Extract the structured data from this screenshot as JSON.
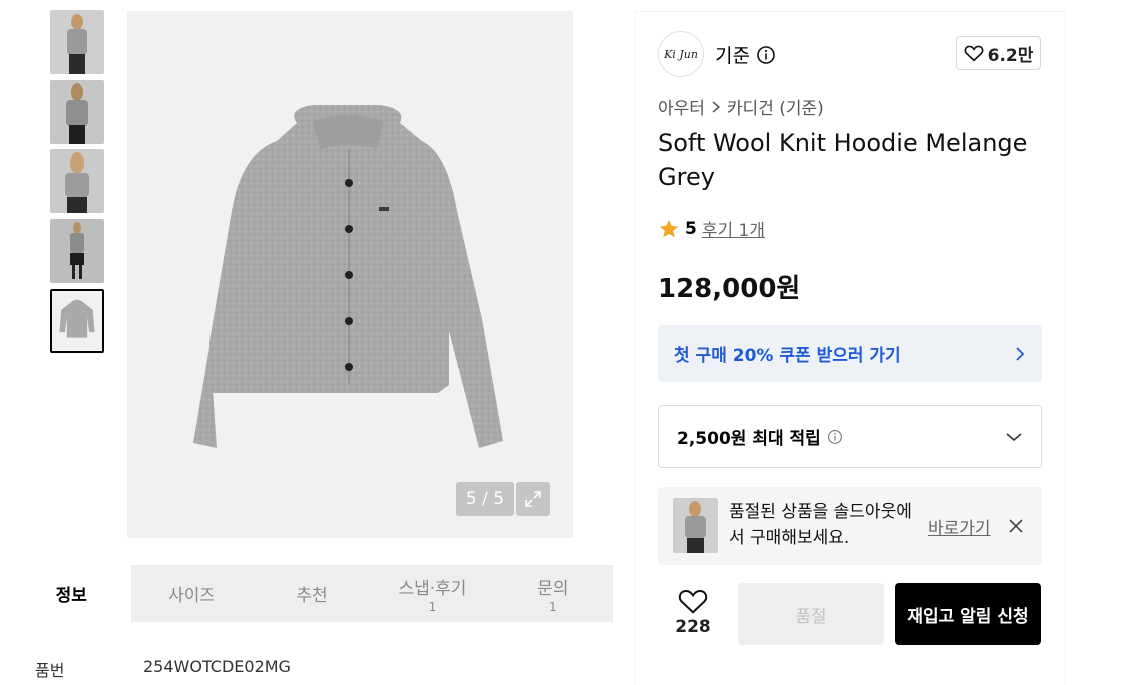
{
  "gallery": {
    "counter": "5 / 5",
    "thumbnails": [
      {
        "icon": "model-front-photo"
      },
      {
        "icon": "model-back-photo"
      },
      {
        "icon": "model-side-photo"
      },
      {
        "icon": "model-full-photo"
      },
      {
        "icon": "product-flat-photo",
        "selected": true
      }
    ]
  },
  "tabs": [
    {
      "label": "정보",
      "count": ""
    },
    {
      "label": "사이즈",
      "count": ""
    },
    {
      "label": "추천",
      "count": ""
    },
    {
      "label": "스냅·후기",
      "count": "1"
    },
    {
      "label": "문의",
      "count": "1"
    }
  ],
  "detail": {
    "label": "품번",
    "value": "254WOTCDE02MG"
  },
  "brand": {
    "logo_text": "Ki Jun",
    "name": "기준",
    "likes": "6.2만"
  },
  "breadcrumb": {
    "level1": "아우터",
    "level2": "카디건 (기준)"
  },
  "product": {
    "title": "Soft Wool Knit Hoodie Melange Grey",
    "rating": "5",
    "reviews": "후기 1개",
    "price": "128,000원"
  },
  "coupon": {
    "label": "첫 구매 20% 쿠폰 받으러 가기"
  },
  "points": {
    "label": "2,500원 최대 적립"
  },
  "soldout_notice": {
    "text": "품절된 상품을 솔드아웃에서 구매해보세요.",
    "link": "바로가기"
  },
  "actions": {
    "wish_count": "228",
    "soldout_label": "품절",
    "restock_label": "재입고 알림 신청"
  },
  "colors": {
    "accent_blue": "#1f5bd8",
    "star": "#f5a623",
    "garment": "#a9a9a9"
  }
}
